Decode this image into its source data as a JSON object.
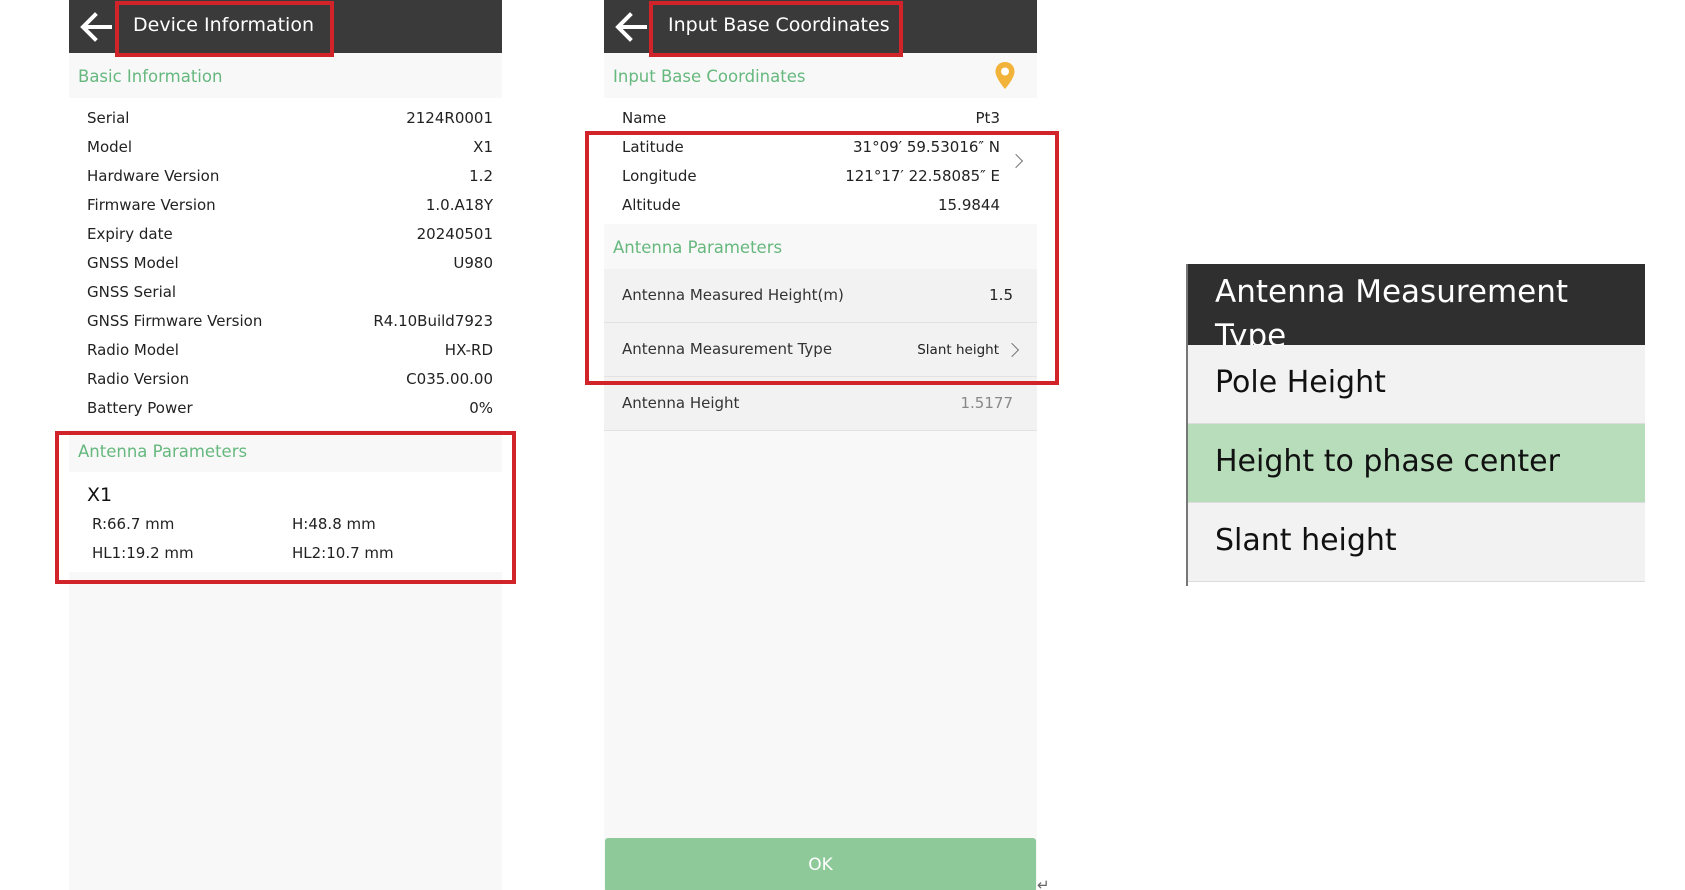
{
  "device_info": {
    "title": "Device Information",
    "basic_section": "Basic Information",
    "rows": [
      {
        "label": "Serial",
        "value": "2124R0001"
      },
      {
        "label": "Model",
        "value": "X1"
      },
      {
        "label": "Hardware Version",
        "value": "1.2"
      },
      {
        "label": "Firmware Version",
        "value": "1.0.A18Y"
      },
      {
        "label": "Expiry date",
        "value": "20240501"
      },
      {
        "label": "GNSS Model",
        "value": "U980"
      },
      {
        "label": "GNSS Serial",
        "value": ""
      },
      {
        "label": "GNSS Firmware Version",
        "value": "R4.10Build7923"
      },
      {
        "label": "Radio Model",
        "value": "HX-RD"
      },
      {
        "label": "Radio Version",
        "value": "C035.00.00"
      },
      {
        "label": "Battery Power",
        "value": "0%"
      }
    ],
    "antenna_section": "Antenna Parameters",
    "antenna": {
      "model": "X1",
      "r": "R:66.7 mm",
      "h": "H:48.8 mm",
      "hl1": "HL1:19.2 mm",
      "hl2": "HL2:10.7 mm"
    }
  },
  "base_coords": {
    "title": "Input Base Coordinates",
    "section": "Input Base Coordinates",
    "name_label": "Name",
    "name_value": "Pt3",
    "latitude_label": "Latitude",
    "latitude_value": "31°09′ 59.53016″ N",
    "longitude_label": "Longitude",
    "longitude_value": "121°17′ 22.58085″ E",
    "altitude_label": "Altitude",
    "altitude_value": "15.9844",
    "antenna_section": "Antenna Parameters",
    "measured_height_label": "Antenna Measured Height(m)",
    "measured_height_value": "1.5",
    "measurement_type_label": "Antenna Measurement Type",
    "measurement_type_value": "Slant height",
    "antenna_height_label": "Antenna Height",
    "antenna_height_value": "1.5177",
    "ok_label": "OK"
  },
  "measurement_popup": {
    "title": "Antenna Measurement Type",
    "options": [
      {
        "label": "Pole Height"
      },
      {
        "label": "Height to phase center"
      },
      {
        "label": "Slant height"
      }
    ],
    "selected_option": "Height to phase center"
  },
  "colors": {
    "appbar": "#3a3a3a",
    "accent_green": "#66b87e",
    "ok_button": "#8ec99a",
    "selected_option": "#b7ddbb",
    "highlight_red": "#d0232a",
    "location_pin": "#f2b33a"
  },
  "icons": {
    "back": "arrow-left-icon",
    "location": "location-pin-icon",
    "chevron": "chevron-right-icon"
  }
}
